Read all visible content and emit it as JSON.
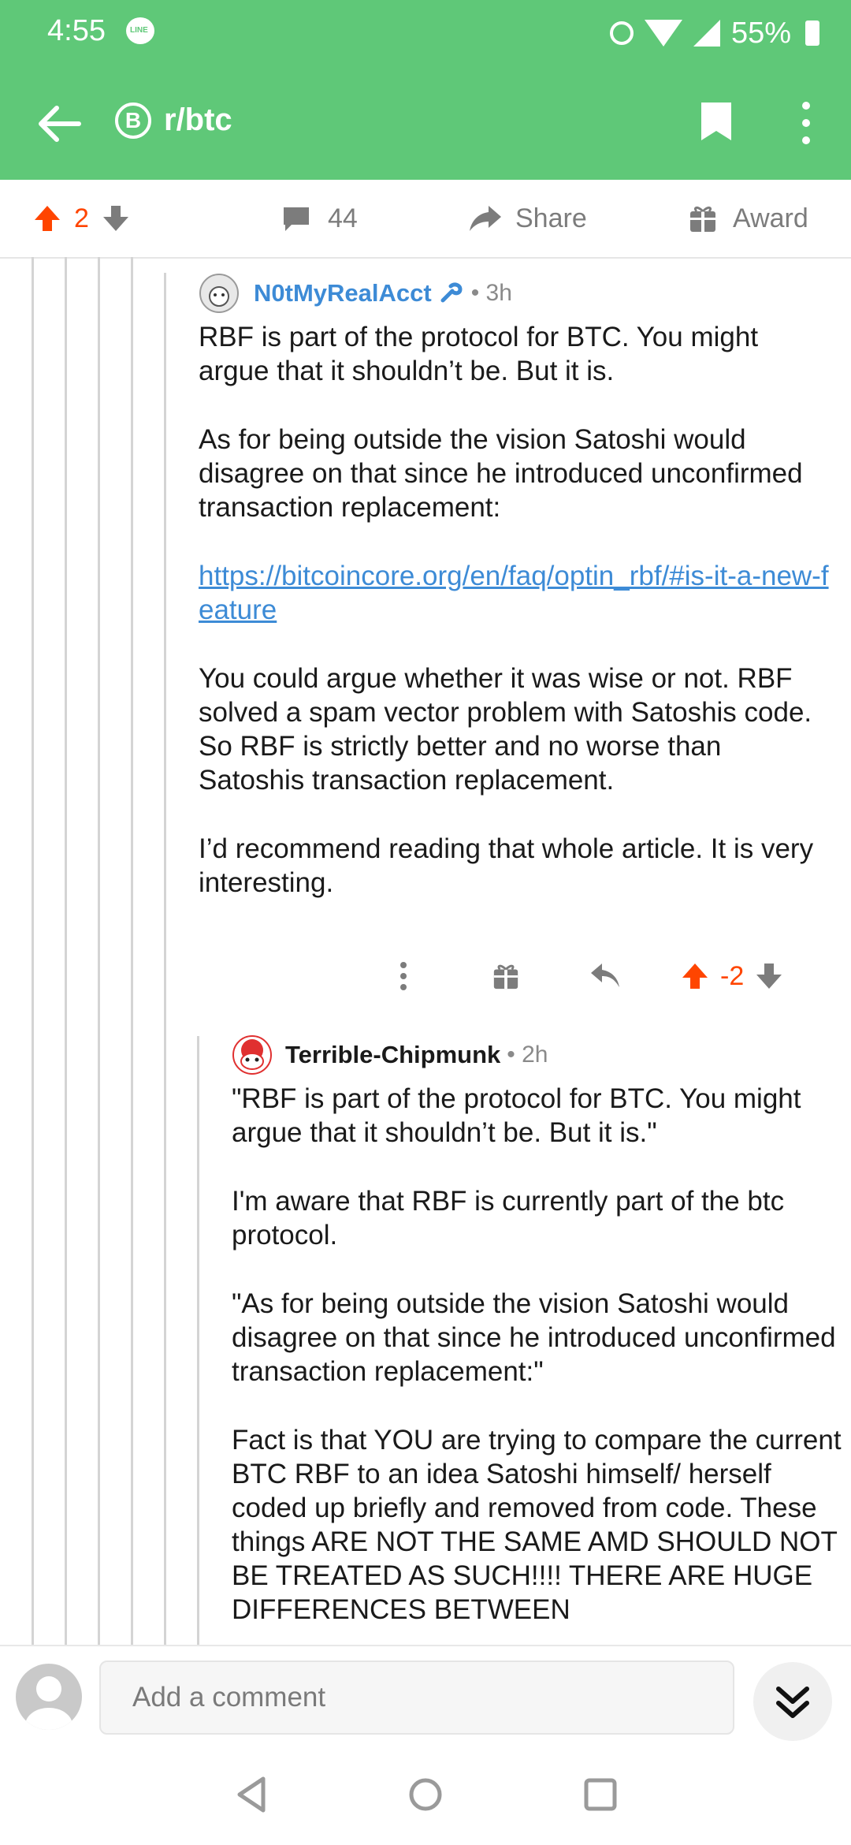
{
  "status": {
    "time": "4:55",
    "line_badge": "LINE",
    "battery": "55%"
  },
  "header": {
    "subreddit": "r/btc",
    "sub_icon": "B"
  },
  "post_actions": {
    "score": "2",
    "comments": "44",
    "share": "Share",
    "award": "Award"
  },
  "comments": [
    {
      "author": "N0tMyRealAcct",
      "age": "• 3h",
      "paragraphs": [
        "RBF is part of the protocol for BTC. You might argue that it shouldn’t be. But it is.",
        "As for being outside the vision Satoshi would disagree on that since he introduced unconfirmed transaction replacement:",
        "You could argue whether it was wise or not. RBF solved a spam vector problem with Satoshis code. So RBF is strictly better and no worse than Satoshis transaction replacement.",
        "I’d recommend reading that whole article. It is very interesting."
      ],
      "link": "https://bitcoincore.org/en/faq/optin_rbf/#is-it-a-new-feature",
      "score": "-2"
    },
    {
      "author": "Terrible-Chipmunk",
      "age": "• 2h",
      "paragraphs": [
        "\"RBF is part of the protocol for BTC. You might argue that it shouldn’t be. But it is.\"",
        "I'm aware that RBF is currently part of the btc protocol.",
        "\"As for being outside the vision Satoshi would disagree on that since he introduced unconfirmed transaction replacement:\"",
        "Fact is that YOU are trying to compare the current BTC RBF to an idea Satoshi himself/ herself coded up briefly and removed from code.  These things ARE NOT THE SAME AMD SHOULD NOT BE TREATED AS SUCH!!!! THERE ARE HUGE DIFFERENCES BETWEEN"
      ]
    }
  ],
  "composer": {
    "placeholder": "Add a comment"
  },
  "icons": {
    "upvote": "upvote-arrow-icon",
    "downvote": "downvote-arrow-icon",
    "comments": "speech-bubble-icon",
    "share": "share-arrow-icon",
    "award": "gift-icon",
    "reply": "reply-arrow-icon",
    "more": "vertical-dots-icon",
    "bookmark": "bookmark-icon",
    "back": "back-arrow-icon",
    "jump": "double-chevron-down-icon"
  },
  "colors": {
    "header": "#5fc878",
    "upvote": "#ff4500",
    "link": "#3d8bd6"
  }
}
